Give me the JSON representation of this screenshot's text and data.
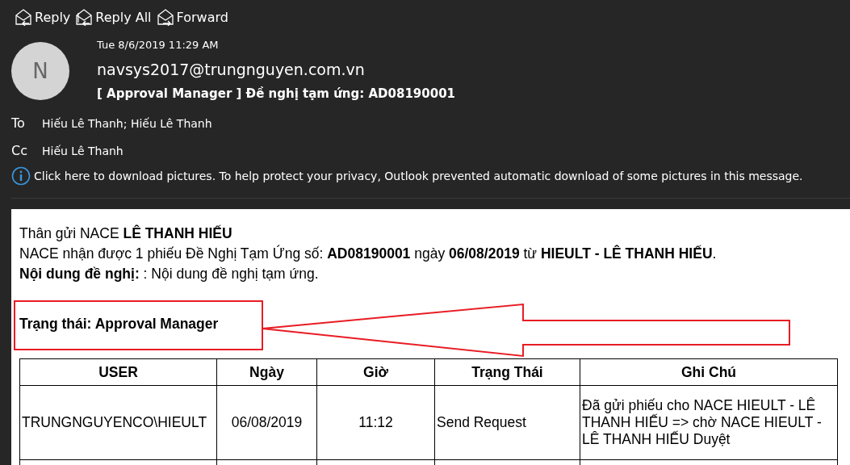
{
  "actions": [
    {
      "kind": "reply",
      "label": "Reply"
    },
    {
      "kind": "reply_all",
      "label": "Reply All"
    },
    {
      "kind": "forward",
      "label": "Forward"
    }
  ],
  "message": {
    "avatar": "N",
    "date": "Tue 8/6/2019 11:29 AM",
    "sender": "navsys2017@trungnguyen.com.vn",
    "subject": "[ Approval Manager ] Đề nghị tạm ứng: AD08190001",
    "to_label": "To",
    "to": "Hiếu Lê Thanh; Hiếu Lê Thanh",
    "cc_label": "Cc",
    "cc": "Hiếu Lê Thanh",
    "info": "Click here to download pictures. To help protect your privacy, Outlook prevented automatic download of some pictures in this message."
  },
  "body": {
    "lines": [
      "Thân gửi NACE **LÊ THANH HIẾU**",
      "NACE nhận được 1 phiếu Đề Nghị Tạm Ứng số: **AD08190001** ngày **06/08/2019** từ **HIEULT - LÊ THANH HIẾU**.",
      "**Nội dung đề nghị:** : Nội dung đề nghị tạm ứng."
    ],
    "status": "Trạng thái: Approval Manager",
    "table": {
      "columns": [
        "USER",
        "Ngày",
        "Giờ",
        "Trạng Thái",
        "Ghi Chú"
      ],
      "rows": [
        [
          "TRUNGNGUYENCO\\HIEULT",
          "06/08/2019",
          "11:12",
          "Send Request",
          "Đã gửi phiếu cho NACE HIEULT - LÊ THANH HIẾU => chờ NACE HIEULT - LÊ THANH HIẾU Duyệt"
        ]
      ]
    }
  }
}
